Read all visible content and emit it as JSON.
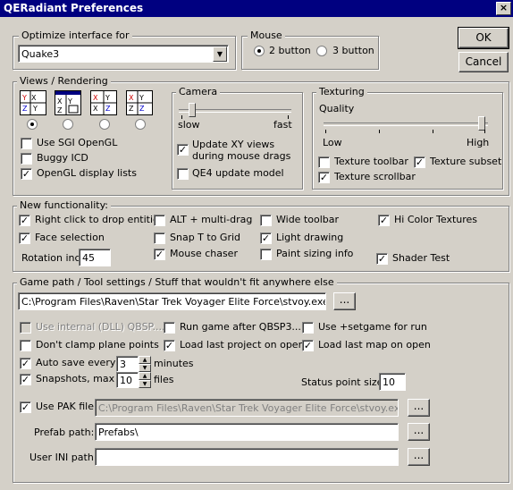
{
  "window": {
    "title": "QERadiant Preferences",
    "close": "×"
  },
  "buttons": {
    "ok": "OK",
    "cancel": "Cancel"
  },
  "optimize": {
    "legend": "Optimize interface for",
    "value": "Quake3"
  },
  "mouse": {
    "legend": "Mouse",
    "two_button": "2 button",
    "three_button": "3 button",
    "selected": "2 button"
  },
  "views": {
    "legend": "Views / Rendering",
    "layouts": [
      "layout-1",
      "layout-2",
      "layout-3",
      "layout-4"
    ],
    "selected_layout": 1,
    "use_sgi": "Use SGI OpenGL",
    "buggy_icd": "Buggy ICD",
    "display_lists": "OpenGL display lists"
  },
  "camera": {
    "legend": "Camera",
    "slow": "slow",
    "fast": "fast",
    "speed": 0.1,
    "update_xy": "Update XY views during mouse drags",
    "qe4": "QE4 update model"
  },
  "texturing": {
    "legend": "Texturing",
    "quality": "Quality",
    "low": "Low",
    "high": "High",
    "quality_value": 1.0,
    "toolbar": "Texture toolbar",
    "subset": "Texture subset",
    "scrollbar": "Texture scrollbar"
  },
  "newfunc": {
    "legend": "New functionality:",
    "right_click": "Right click to drop entities",
    "alt_drag": "ALT + multi-drag",
    "wide_toolbar": "Wide toolbar",
    "hi_color": "Hi Color Textures",
    "face_sel": "Face selection",
    "snap_t": "Snap T to Grid",
    "light_draw": "Light drawing",
    "mouse_chaser": "Mouse chaser",
    "paint_sizing": "Paint sizing info",
    "shader_test": "Shader Test",
    "rotation_label": "Rotation inc:",
    "rotation_value": "45"
  },
  "gamepath": {
    "legend": "Game path / Tool settings / Stuff that wouldn't fit anywhere else",
    "path": "C:\\Program Files\\Raven\\Star Trek Voyager Elite Force\\stvoy.exe",
    "browse": "...",
    "use_internal": "Use internal (DLL) QBSP....",
    "run_game": "Run game after QBSP3...",
    "setgame": "Use +setgame for run",
    "dont_clamp": "Don't clamp plane points",
    "load_project": "Load last project on open",
    "load_map": "Load last map on open",
    "autosave": "Auto save every",
    "autosave_value": "3",
    "minutes": "minutes",
    "snapshots": "Snapshots, max",
    "snapshots_value": "10",
    "files": "files",
    "status_label": "Status point size:",
    "status_value": "10",
    "use_pak": "Use PAK file:",
    "pak_path": "C:\\Program Files\\Raven\\Star Trek Voyager Elite Force\\stvoy.exe",
    "prefab_label": "Prefab path:",
    "prefab_value": "Prefabs\\",
    "user_ini_label": "User INI path:",
    "user_ini_value": ""
  }
}
